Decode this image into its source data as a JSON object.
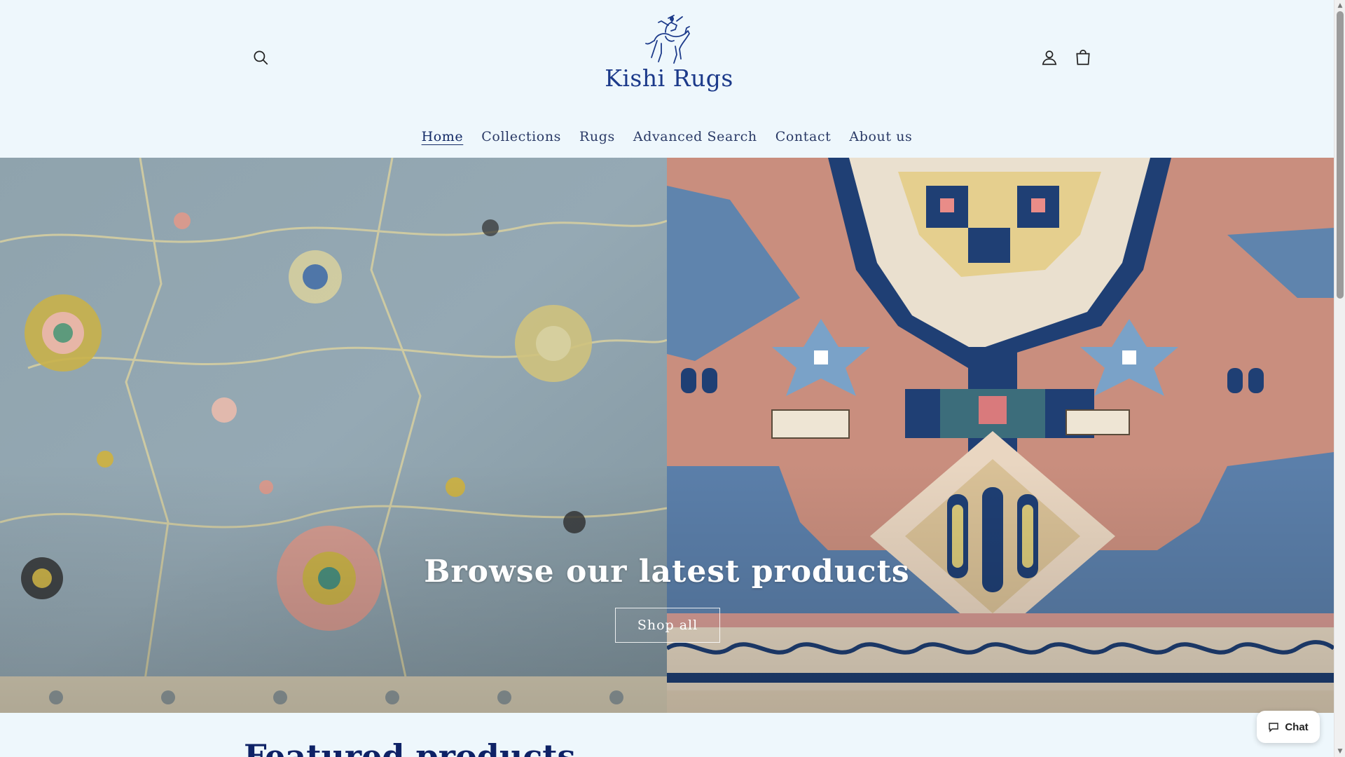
{
  "header": {
    "brand": "Kishi Rugs",
    "logo_icon": "horse-rider-logo",
    "search_icon": "search-icon",
    "account_icon": "user-icon",
    "cart_icon": "cart-icon"
  },
  "nav": {
    "items": [
      {
        "label": "Home",
        "active": true
      },
      {
        "label": "Collections"
      },
      {
        "label": "Rugs"
      },
      {
        "label": "Advanced Search"
      },
      {
        "label": "Contact"
      },
      {
        "label": "About us"
      }
    ]
  },
  "hero": {
    "title": "Browse our latest products",
    "cta_label": "Shop all"
  },
  "featured": {
    "title": "Featured products"
  },
  "chat": {
    "label": "Chat",
    "icon": "chat-bubble-icon"
  },
  "colors": {
    "background": "#eef7fc",
    "brand": "#1c3a8a",
    "nav_text": "#2a3a66",
    "heading": "#0e2266"
  }
}
